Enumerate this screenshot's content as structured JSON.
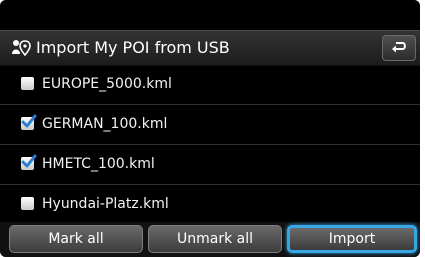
{
  "header": {
    "title": "Import My POI from USB",
    "icon": "poi-usb-icon",
    "back_icon": "back-arrow-icon"
  },
  "files": [
    {
      "name": "EUROPE_5000.kml",
      "checked": false
    },
    {
      "name": "GERMAN_100.kml",
      "checked": true
    },
    {
      "name": "HMETC_100.kml",
      "checked": true
    },
    {
      "name": "Hyundai-Platz.kml",
      "checked": false
    }
  ],
  "buttons": {
    "mark_all": "Mark all",
    "unmark_all": "Unmark all",
    "import": "Import"
  },
  "colors": {
    "accent": "#36a6e6",
    "check": "#2a7fd4",
    "background": "#000000"
  }
}
